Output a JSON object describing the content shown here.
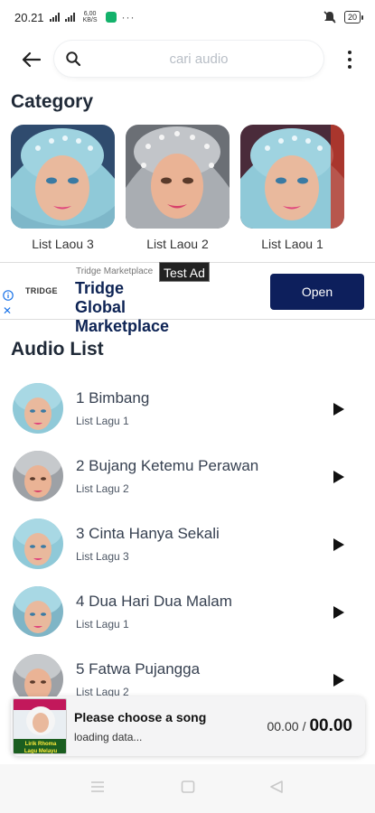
{
  "status_bar": {
    "time": "20.21",
    "net_speed": "6,00 KB/S",
    "battery": "20",
    "more": "···"
  },
  "search": {
    "placeholder": "cari audio"
  },
  "category_section": {
    "title": "Category",
    "items": [
      {
        "label": "List Laou 3"
      },
      {
        "label": "List Laou 2"
      },
      {
        "label": "List Laou 1"
      }
    ]
  },
  "ad": {
    "test_label": "Test Ad",
    "brand": "TRIDGE",
    "advertiser": "Tridge Marketplace",
    "headline": "Tridge Global Marketplace",
    "cta": "Open",
    "close": "✕"
  },
  "audio_section": {
    "title": "Audio List",
    "items": [
      {
        "title": "1 Bimbang",
        "list": "List Lagu 1"
      },
      {
        "title": "2 Bujang Ketemu Perawan",
        "list": "List Lagu 2"
      },
      {
        "title": "3 Cinta Hanya Sekali",
        "list": "List Lagu 3"
      },
      {
        "title": "4 Dua Hari Dua Malam",
        "list": "List Lagu 1"
      },
      {
        "title": "5 Fatwa Pujangga",
        "list": "List Lagu 2"
      }
    ]
  },
  "player": {
    "title": "Please choose a song",
    "status": "loading data...",
    "current_time": "00.00",
    "separator": "/",
    "duration": "00.00",
    "cover_text": "Lirik Rhoma Lagu Melayu"
  },
  "colors": {
    "accent": "#0d1f5c",
    "headline": "#0d2354",
    "player_bg": "#f4f4f5"
  }
}
